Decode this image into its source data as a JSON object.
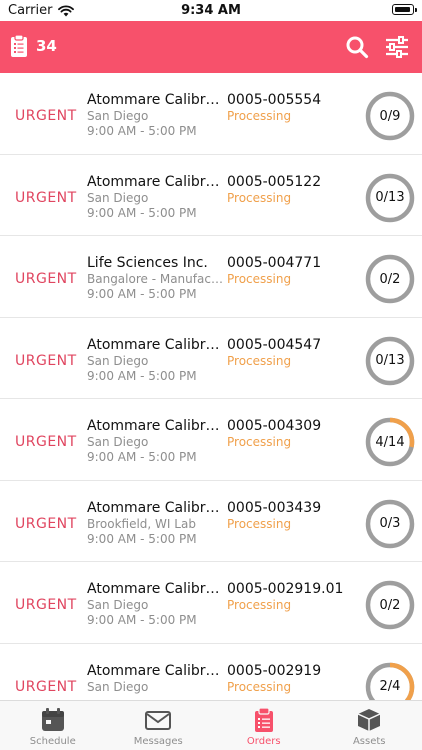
{
  "status_bar": {
    "carrier": "Carrier",
    "time": "9:34 AM"
  },
  "header": {
    "count": "34",
    "bg_color": "#f7516b"
  },
  "orders": [
    {
      "priority": "URGENT",
      "customer": "Atommare Calibrati...",
      "location": "San Diego",
      "hours": "9:00 AM - 5:00 PM",
      "order_no": "0005-005554",
      "status": "Processing",
      "progress_label": "0/9",
      "done": 0,
      "total": 9
    },
    {
      "priority": "URGENT",
      "customer": "Atommare Calibrati...",
      "location": "San Diego",
      "hours": "9:00 AM - 5:00 PM",
      "order_no": "0005-005122",
      "status": "Processing",
      "progress_label": "0/13",
      "done": 0,
      "total": 13
    },
    {
      "priority": "URGENT",
      "customer": "Life Sciences Inc.",
      "location": "Bangalore - Manufactur...",
      "hours": "9:00 AM - 5:00 PM",
      "order_no": "0005-004771",
      "status": "Processing",
      "progress_label": "0/2",
      "done": 0,
      "total": 2
    },
    {
      "priority": "URGENT",
      "customer": "Atommare Calibrati...",
      "location": "San Diego",
      "hours": "9:00 AM - 5:00 PM",
      "order_no": "0005-004547",
      "status": "Processing",
      "progress_label": "0/13",
      "done": 0,
      "total": 13
    },
    {
      "priority": "URGENT",
      "customer": "Atommare Calibrati...",
      "location": "San Diego",
      "hours": "9:00 AM - 5:00 PM",
      "order_no": "0005-004309",
      "status": "Processing",
      "progress_label": "4/14",
      "done": 4,
      "total": 14
    },
    {
      "priority": "URGENT",
      "customer": "Atommare Calibrati...",
      "location": "Brookfield, WI Lab",
      "hours": "9:00 AM - 5:00 PM",
      "order_no": "0005-003439",
      "status": "Processing",
      "progress_label": "0/3",
      "done": 0,
      "total": 3
    },
    {
      "priority": "URGENT",
      "customer": "Atommare Calibrati...",
      "location": "San Diego",
      "hours": "9:00 AM - 5:00 PM",
      "order_no": "0005-002919.01",
      "status": "Processing",
      "progress_label": "0/2",
      "done": 0,
      "total": 2
    },
    {
      "priority": "URGENT",
      "customer": "Atommare Calibrati...",
      "location": "San Diego",
      "hours": "",
      "order_no": "0005-002919",
      "status": "Processing",
      "progress_label": "2/4",
      "done": 2,
      "total": 4
    }
  ],
  "tabs": [
    {
      "label": "Schedule",
      "icon": "calendar-icon",
      "active": false
    },
    {
      "label": "Messages",
      "icon": "envelope-icon",
      "active": false
    },
    {
      "label": "Orders",
      "icon": "clipboard-icon",
      "active": true
    },
    {
      "label": "Assets",
      "icon": "box-icon",
      "active": false
    }
  ],
  "colors": {
    "accent": "#f7516b",
    "urgent": "#e04660",
    "processing": "#f0a04b",
    "ring_track": "#9e9e9e",
    "ring_progress": "#f0a04b"
  }
}
